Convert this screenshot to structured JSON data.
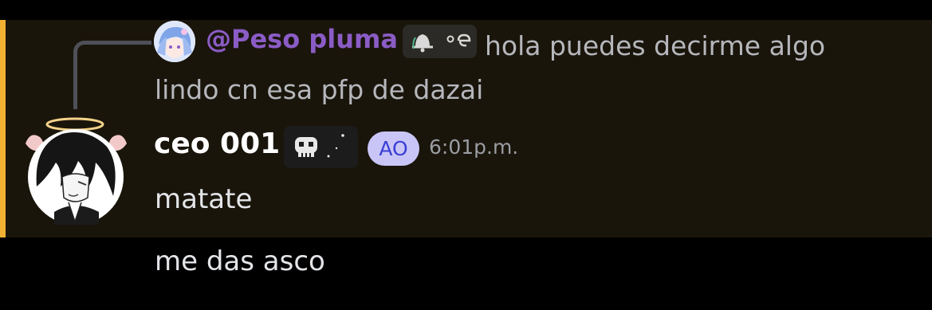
{
  "reply": {
    "author": "@Peso pluma",
    "text": "hola puedes decirme algo lindo cn esa pfp de dazai",
    "tag_icon": "bell-tag-icon"
  },
  "message": {
    "author": "ceo 001",
    "tag_icon": "skull-tag-icon",
    "role_badge": "AO",
    "timestamp": "6:01p.m.",
    "lines": [
      "matate",
      "me das asco"
    ]
  },
  "colors": {
    "mention_highlight_bg": "#1a150b",
    "mention_bar": "#f0b132",
    "reply_author": "#8b5cc6",
    "role_badge_bg": "#c9c6f7",
    "role_badge_text": "#3a3fd6"
  }
}
